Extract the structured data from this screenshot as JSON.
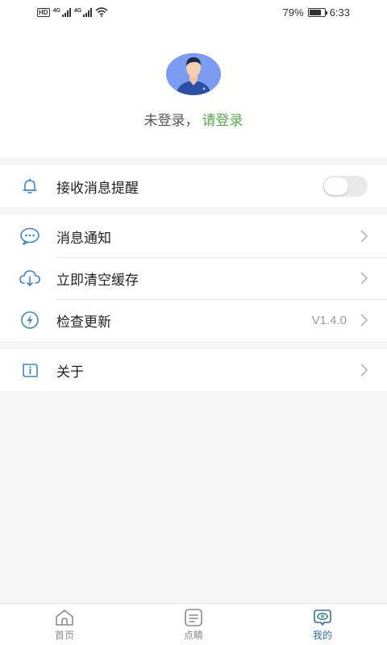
{
  "status_bar": {
    "hd": "HD",
    "network_1": "4G",
    "network_2": "4G",
    "battery_text": "79%",
    "battery_level": 0.79,
    "time": "6:33"
  },
  "profile": {
    "not_logged_in": "未登录，",
    "login_link": "请登录"
  },
  "settings": {
    "notify_toggle": {
      "label": "接收消息提醒",
      "on": false
    },
    "messages": {
      "label": "消息通知"
    },
    "clear_cache": {
      "label": "立即清空缓存"
    },
    "check_update": {
      "label": "检查更新",
      "version": "V1.4.0"
    },
    "about": {
      "label": "关于"
    }
  },
  "tabbar": {
    "items": [
      {
        "label": "首页",
        "icon": "home-icon"
      },
      {
        "label": "点睛",
        "icon": "notes-icon"
      },
      {
        "label": "我的",
        "icon": "profile-eye-icon"
      }
    ],
    "active_index": 2
  },
  "colors": {
    "accent_green": "#5aa84d",
    "icon_blue": "#3d86c6",
    "active_tab": "#2e6f9e"
  }
}
